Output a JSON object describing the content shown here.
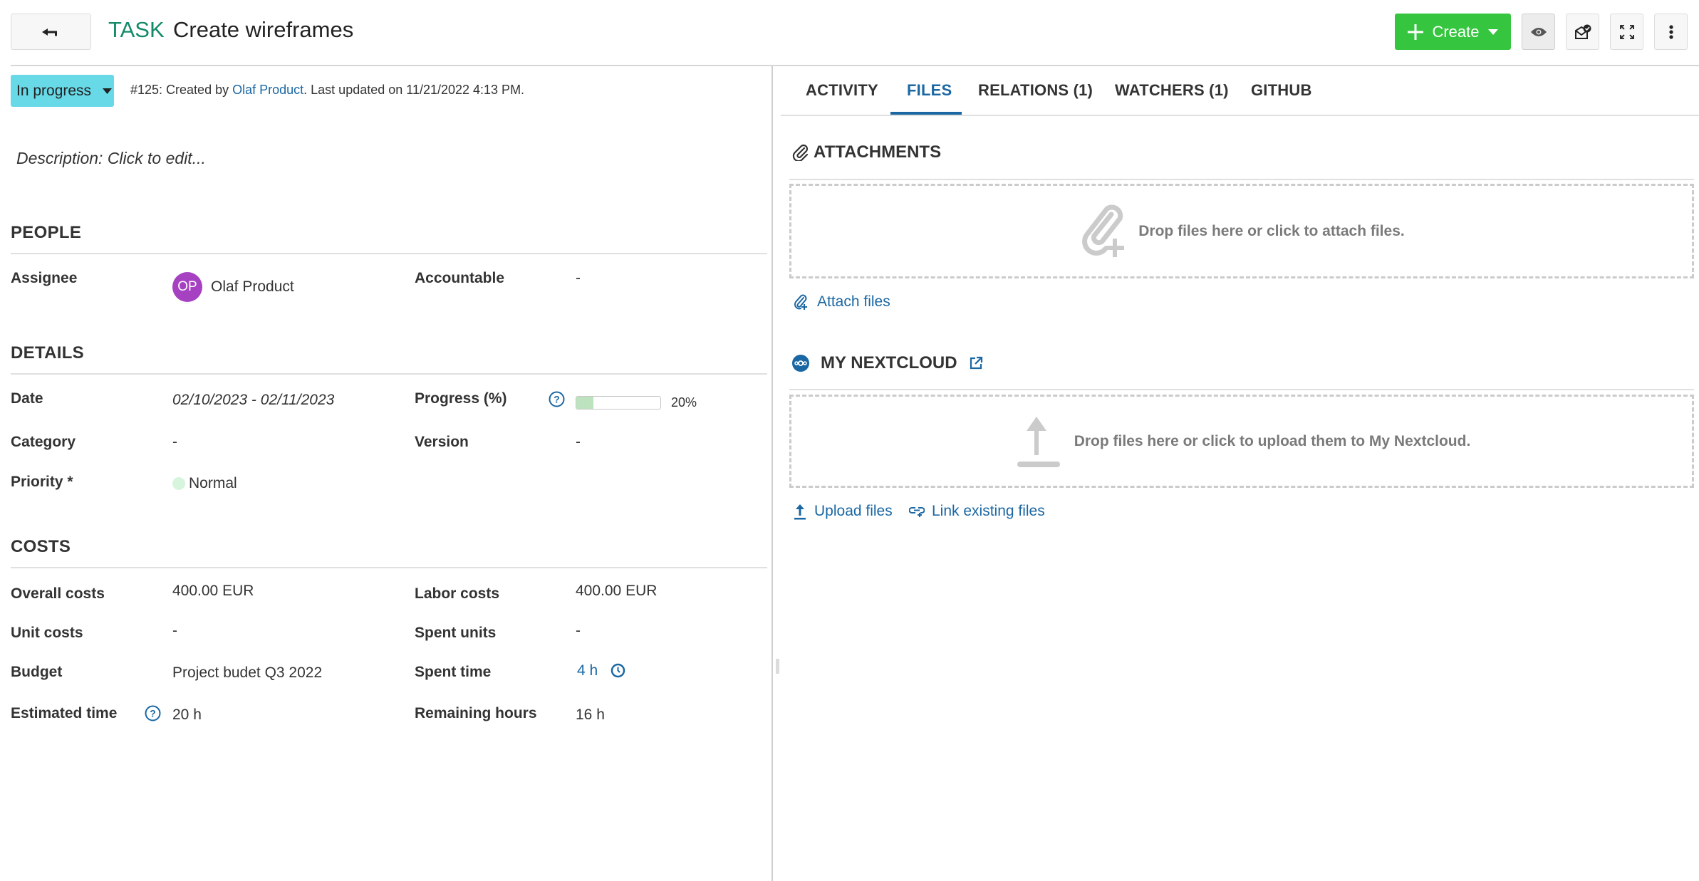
{
  "header": {
    "back_label": "Back",
    "type": "TASK",
    "title": "Create wireframes",
    "create_label": "Create",
    "type_color": "#148a6a",
    "create_color": "#35c53f"
  },
  "status": {
    "label": "In progress",
    "color": "#67d9e7"
  },
  "meta": {
    "prefix": "#125: Created by ",
    "author": "Olaf Product",
    "suffix": ". Last updated on 11/21/2022 4:13 PM."
  },
  "description": "Description: Click to edit...",
  "people": {
    "title": "PEOPLE",
    "assignee_label": "Assignee",
    "assignee_initials": "OP",
    "assignee_name": "Olaf Product",
    "avatar_color": "#a642c2",
    "accountable_label": "Accountable",
    "accountable_value": "-"
  },
  "details": {
    "title": "DETAILS",
    "date_label": "Date",
    "date_value": "02/10/2023 - 02/11/2023",
    "progress_label": "Progress (%)",
    "progress_value": 20,
    "progress_text": "20%",
    "category_label": "Category",
    "category_value": "-",
    "version_label": "Version",
    "version_value": "-",
    "priority_label": "Priority *",
    "priority_value": "Normal",
    "priority_color": "#d7f5dd"
  },
  "costs": {
    "title": "COSTS",
    "overall_label": "Overall costs",
    "overall_value": "400.00 EUR",
    "labor_label": "Labor costs",
    "labor_value": "400.00 EUR",
    "unit_label": "Unit costs",
    "unit_value": "-",
    "spent_units_label": "Spent units",
    "spent_units_value": "-",
    "budget_label": "Budget",
    "budget_value": "Project budet Q3 2022",
    "spent_time_label": "Spent time",
    "spent_time_value": "4 h",
    "estimated_label": "Estimated time",
    "estimated_value": "20 h",
    "remaining_label": "Remaining hours",
    "remaining_value": "16 h"
  },
  "tabs": [
    {
      "label": "ACTIVITY",
      "active": false
    },
    {
      "label": "FILES",
      "active": true
    },
    {
      "label": "RELATIONS (1)",
      "active": false
    },
    {
      "label": "WATCHERS (1)",
      "active": false
    },
    {
      "label": "GITHUB",
      "active": false
    }
  ],
  "attachments": {
    "title": "ATTACHMENTS",
    "drop_text": "Drop files here or click to attach files.",
    "attach_link": "Attach files"
  },
  "nextcloud": {
    "title": "MY NEXTCLOUD",
    "drop_text": "Drop files here or click to upload them to My Nextcloud.",
    "upload_link": "Upload files",
    "link_existing": "Link existing files"
  },
  "icons": {
    "back": "back-arrow-icon",
    "create_plus": "plus-icon",
    "create_caret": "caret-down-icon",
    "watch": "eye-icon",
    "notifications": "mail-check-icon",
    "fullscreen": "expand-icon",
    "more": "kebab-menu-icon",
    "status_caret": "caret-down-icon",
    "help": "help-circle-icon",
    "spent_time": "clock-icon",
    "attachment": "paperclip-icon",
    "attach_drop": "paperclip-plus-icon",
    "nextcloud": "nextcloud-icon",
    "external": "external-link-icon",
    "upload_drop": "upload-arrow-icon",
    "upload": "upload-icon",
    "link": "link-icon"
  }
}
